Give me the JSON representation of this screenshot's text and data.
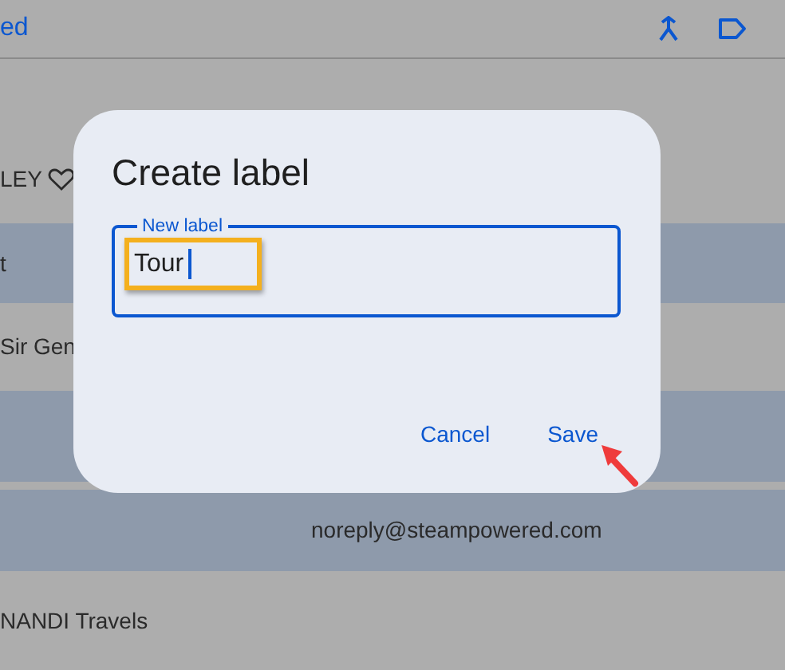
{
  "toolbar": {
    "title": "ed"
  },
  "rows": [
    {
      "column_1": "LEY",
      "favorite": true,
      "selected": false
    },
    {
      "column_1": "t",
      "favorite": false,
      "selected": true
    },
    {
      "column_1": "Sir Gen",
      "favorite": false,
      "selected": false
    },
    {
      "favorite": false,
      "selected": true
    },
    {
      "column_2": "noreply@steampowered.com",
      "favorite": false,
      "selected": true
    },
    {
      "column_1": "NANDI Travels",
      "favorite": false,
      "selected": false
    }
  ],
  "dialog": {
    "title": "Create label",
    "field": {
      "label": "New label",
      "value": "Tour",
      "focused": true
    },
    "buttons": [
      {
        "label": "Cancel"
      },
      {
        "label": "Save"
      }
    ]
  },
  "annotations": {
    "input_highlight": true,
    "save_arrow": true
  }
}
